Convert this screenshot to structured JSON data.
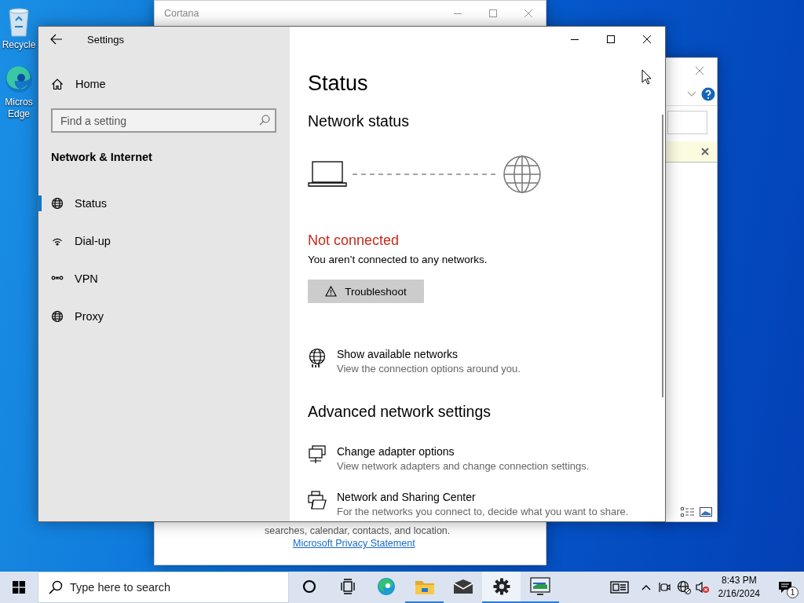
{
  "desktop_icons": [
    {
      "kind": "recycle_bin",
      "label": [
        "Recycle"
      ]
    },
    {
      "kind": "edge",
      "label": [
        "Micros",
        "Edge"
      ]
    }
  ],
  "cortana_window": {
    "title": "Cortana",
    "text": "searches, calendar, contacts, and location.",
    "link": "Microsoft Privacy Statement"
  },
  "settings_window": {
    "title": "Settings",
    "sidebar": {
      "home": "Home",
      "search_placeholder": "Find a setting",
      "section": "Network & Internet",
      "items": [
        {
          "kind": "status",
          "label": "Status",
          "selected": true
        },
        {
          "kind": "dialup",
          "label": "Dial-up",
          "selected": false
        },
        {
          "kind": "vpn",
          "label": "VPN",
          "selected": false
        },
        {
          "kind": "proxy",
          "label": "Proxy",
          "selected": false
        }
      ]
    },
    "page": {
      "title": "Status",
      "heading": "Network status",
      "connected": false,
      "status": "Not connected",
      "message": "You aren’t connected to any networks.",
      "button": "Troubleshoot",
      "links": [
        {
          "kind": "networks",
          "title": "Show available networks",
          "description": "View the connection options around you."
        }
      ],
      "advanced_heading": "Advanced network settings",
      "advanced_links": [
        {
          "kind": "adapter",
          "title": "Change adapter options",
          "description": "View network adapters and change connection settings."
        },
        {
          "kind": "sharing",
          "title": "Network and Sharing Center",
          "description": "For the networks you connect to, decide what you want to share."
        }
      ]
    }
  },
  "taskbar": {
    "search_placeholder": "Type here to search",
    "apps": [
      {
        "kind": "cortana",
        "running": false,
        "active": false
      },
      {
        "kind": "task_view",
        "running": false,
        "active": false
      },
      {
        "kind": "edge",
        "running": false,
        "active": false
      },
      {
        "kind": "explorer",
        "running": true,
        "active": false
      },
      {
        "kind": "mail",
        "running": false,
        "active": false
      },
      {
        "kind": "settings",
        "running": true,
        "active": true
      },
      {
        "kind": "app",
        "running": true,
        "active": false
      }
    ],
    "time": "8:43 PM",
    "date": "2/16/2024",
    "notifications": "1"
  }
}
